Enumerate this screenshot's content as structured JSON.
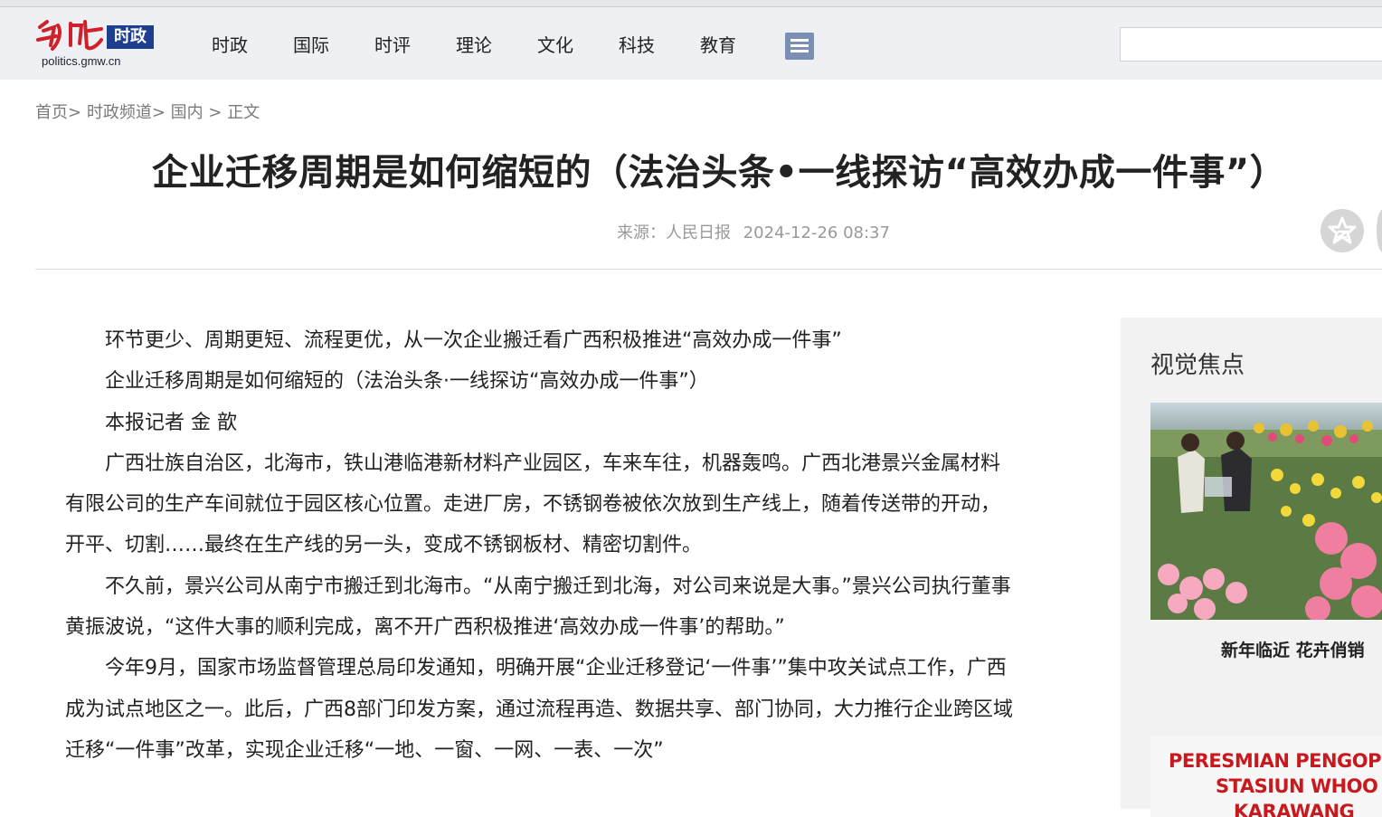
{
  "site": {
    "logo_text": "时政",
    "domain": "politics.gmw.cn"
  },
  "nav": {
    "items": [
      "时政",
      "国际",
      "时评",
      "理论",
      "文化",
      "科技",
      "教育"
    ]
  },
  "search": {
    "value": ""
  },
  "breadcrumb": {
    "home": "首页",
    "channel": "时政频道",
    "section": "国内",
    "current": "正文",
    "sep1": ">",
    "sep2": ">",
    "sep3": " > "
  },
  "article": {
    "title": "企业迁移周期是如何缩短的（法治头条•一线探访“高效办成一件事”）",
    "source": "来源：人民日报",
    "datetime": "2024-12-26 08:37",
    "paragraphs": [
      "环节更少、周期更短、流程更优，从一次企业搬迁看广西积极推进“高效办成一件事”",
      "企业迁移周期是如何缩短的（法治头条·一线探访“高效办成一件事”）",
      "本报记者 金 歆",
      "广西壮族自治区，北海市，铁山港临港新材料产业园区，车来车往，机器轰鸣。广西北港景兴金属材料有限公司的生产车间就位于园区核心位置。走进厂房，不锈钢卷被依次放到生产线上，随着传送带的开动，开平、切割……最终在生产线的另一头，变成不锈钢板材、精密切割件。",
      "不久前，景兴公司从南宁市搬迁到北海市。“从南宁搬迁到北海，对公司来说是大事。”景兴公司执行董事黄振波说，“这件大事的顺利完成，离不开广西积极推进‘高效办成一件事’的帮助。”",
      "今年9月，国家市场监督管理总局印发通知，明确开展“企业迁移登记‘一件事’”集中攻关试点工作，广西成为试点地区之一。此后，广西8部门印发方案，通过流程再造、数据共享、部门协同，大力推行企业跨区域迁移“一件事”改革，实现企业迁移“一地、一窗、一网、一表、一次”"
    ]
  },
  "sidebar": {
    "title": "视觉焦点",
    "photo1_caption": "新年临近 花卉俏销",
    "photo2_text_line1": "PERESMIAN PENGOPE",
    "photo2_text_line2": "STASIUN WHOO",
    "photo2_text_line3": "KARAWANG"
  },
  "colors": {
    "header_bg": "#eef0f3",
    "logo_red": "#d0202a",
    "logo_badge": "#1e3f8f",
    "menu_button": "#7b8fb4",
    "sidebar_bg": "#f2f2f2"
  },
  "icons": {
    "menu": "list-menu-icon",
    "favorite": "star-icon"
  }
}
